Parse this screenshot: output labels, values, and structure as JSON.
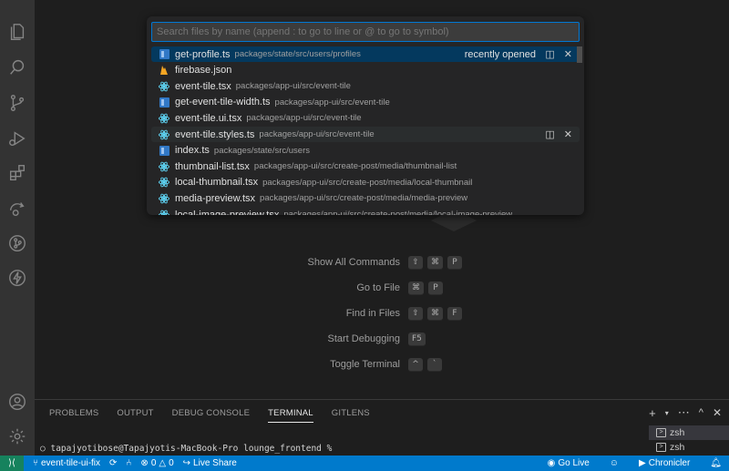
{
  "quick_open": {
    "placeholder": "Search files by name (append : to go to line or @ to go to symbol)",
    "recently_opened": "recently opened",
    "items": [
      {
        "name": "get-profile.ts",
        "path": "packages/state/src/users/profiles",
        "icon": "ts-file-icon"
      },
      {
        "name": "firebase.json",
        "path": "",
        "icon": "firebase-file-icon"
      },
      {
        "name": "event-tile.tsx",
        "path": "packages/app-ui/src/event-tile",
        "icon": "react-file-icon"
      },
      {
        "name": "get-event-tile-width.ts",
        "path": "packages/app-ui/src/event-tile",
        "icon": "ts-file-icon"
      },
      {
        "name": "event-tile.ui.tsx",
        "path": "packages/app-ui/src/event-tile",
        "icon": "react-file-icon"
      },
      {
        "name": "event-tile.styles.ts",
        "path": "packages/app-ui/src/event-tile",
        "icon": "react-file-icon"
      },
      {
        "name": "index.ts",
        "path": "packages/state/src/users",
        "icon": "ts-file-icon"
      },
      {
        "name": "thumbnail-list.tsx",
        "path": "packages/app-ui/src/create-post/media/thumbnail-list",
        "icon": "react-file-icon"
      },
      {
        "name": "local-thumbnail.tsx",
        "path": "packages/app-ui/src/create-post/media/local-thumbnail",
        "icon": "react-file-icon"
      },
      {
        "name": "media-preview.tsx",
        "path": "packages/app-ui/src/create-post/media/media-preview",
        "icon": "react-file-icon"
      },
      {
        "name": "local-image-preview.tsx",
        "path": "packages/app-ui/src/create-post/media/local-image-preview",
        "icon": "react-file-icon"
      }
    ]
  },
  "shortcuts": [
    {
      "label": "Show All Commands",
      "keys": [
        "⇧",
        "⌘",
        "P"
      ]
    },
    {
      "label": "Go to File",
      "keys": [
        "⌘",
        "P"
      ]
    },
    {
      "label": "Find in Files",
      "keys": [
        "⇧",
        "⌘",
        "F"
      ]
    },
    {
      "label": "Start Debugging",
      "keys": [
        "F5"
      ]
    },
    {
      "label": "Toggle Terminal",
      "keys": [
        "^",
        "`"
      ]
    }
  ],
  "panel": {
    "tabs": [
      "PROBLEMS",
      "OUTPUT",
      "DEBUG CONSOLE",
      "TERMINAL",
      "GITLENS"
    ],
    "active_tab": "TERMINAL",
    "terminal_prompt": "tapajyotibose@Tapajyotis-MacBook-Pro lounge_frontend %",
    "terminals": [
      "zsh",
      "zsh"
    ]
  },
  "status_bar": {
    "branch": "event-tile-ui-fix",
    "errors": "0",
    "warnings": "0",
    "live_share": "Live Share",
    "go_live": "Go Live",
    "chronicler": "Chronicler"
  },
  "colors": {
    "accent": "#007acc",
    "selection": "#04395e",
    "ts_icon": "#3178c6",
    "react_icon": "#61dafb",
    "firebase_icon": "#f5a623"
  }
}
